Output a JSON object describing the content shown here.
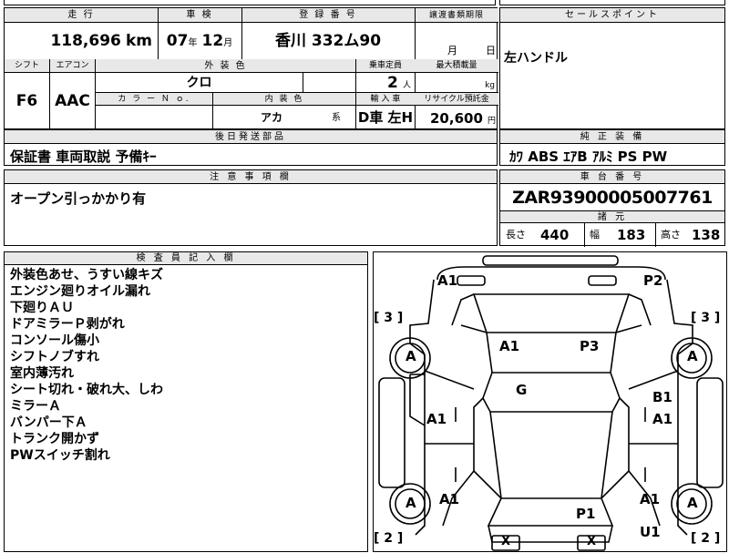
{
  "vehicle": {
    "mileage_label": "走 行",
    "mileage_value": "118,696",
    "mileage_unit": "km",
    "inspection_label": "車 検",
    "inspection_year": "07",
    "inspection_year_unit": "年",
    "inspection_month": "12",
    "inspection_month_unit": "月",
    "plate_label": "登 録 番 号",
    "plate_value": "香川 332ム90",
    "transfer_label": "譲渡書類期限",
    "transfer_month_unit": "月",
    "transfer_day_unit": "日",
    "shift_label": "シフト",
    "shift_value": "F6",
    "aircon_label": "エアコン",
    "aircon_value": "AAC",
    "exterior_label": "外 装 色",
    "exterior_value": "クロ",
    "color_no_label": "カ ラ ー Ｎ ｏ.",
    "interior_label": "内 装 色",
    "interior_value": "アカ",
    "interior_suffix": "系",
    "capacity_label": "乗車定員",
    "capacity_value": "2",
    "capacity_unit": "人",
    "load_label": "最大積載量",
    "load_unit": "kg",
    "import_label": "輸 入 車",
    "import_value": "D車 左H",
    "recycle_label": "リサイクル預託金",
    "recycle_value": "20,600",
    "recycle_unit": "円"
  },
  "sales_point": {
    "label": "セールスポイント",
    "text": "左ハンドル"
  },
  "delivery": {
    "label": "後日発送部品",
    "text": "保証書 車両取説 予備ｷｰ"
  },
  "equipment": {
    "label": "純 正 装 備",
    "text": "ｶﾜ ABS ｴｱB ｱﾙﾐ PS PW"
  },
  "caution": {
    "label": "注 意 事 項 欄",
    "text": "オープン引っかかり有"
  },
  "chassis": {
    "label": "車 台 番 号",
    "value": "ZAR93900005007761"
  },
  "specs": {
    "label": "諸 元",
    "length_label": "長さ",
    "length_value": "440",
    "width_label": "幅",
    "width_value": "183",
    "height_label": "高さ",
    "height_value": "138"
  },
  "inspector": {
    "label": "検 査 員 記 入 欄",
    "notes": [
      "外装色あせ、うすい線キズ",
      "エンジン廻りオイル漏れ",
      "下廻りＡＵ",
      "ドアミラーＰ剥がれ",
      "コンソール傷小",
      "シフトノブすれ",
      "室内薄汚れ",
      "シート切れ・破れ大、しわ",
      "ミラーＡ",
      "バンパー下Ａ",
      "トランク開かず",
      "PWスイッチ割れ"
    ]
  },
  "diagram": {
    "bracket_left_top": "[ 3 ]",
    "bracket_right_top": "[ 3 ]",
    "bracket_left_bottom": "[ 2 ]",
    "bracket_right_bottom": "[ 2 ]",
    "marks": {
      "front_left": "A1",
      "front_right": "P2",
      "hood_left": "A1",
      "hood_right": "P3",
      "roof": "G",
      "left_door": "A1",
      "right_door_upper": "B1",
      "right_door_lower": "A1",
      "rear_left": "A1",
      "rear_right": "A1",
      "trunk": "P1",
      "rear_bottom": "U1",
      "bumper_left": "X",
      "bumper_right": "X",
      "tire_fl": "A",
      "tire_fr": "A",
      "tire_rl": "A",
      "tire_rr": "A"
    }
  }
}
